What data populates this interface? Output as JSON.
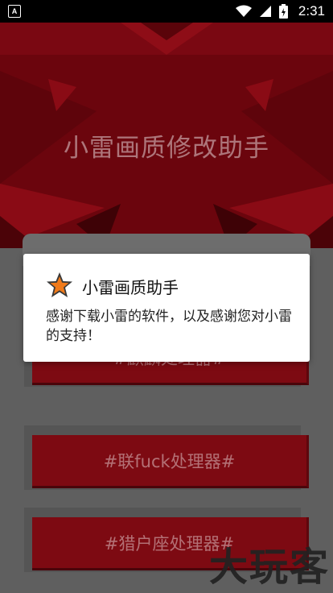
{
  "status_bar": {
    "app_icon_letter": "A",
    "time": "2:31"
  },
  "banner": {
    "title": "小雷画质修改助手"
  },
  "buttons": [
    {
      "label": "#麒麟处理器#"
    },
    {
      "label": "#联fuck处理器#"
    },
    {
      "label": "#猎户座处理器#"
    }
  ],
  "dialog": {
    "title": "小雷画质助手",
    "message": "感谢下载小雷的软件，以及感谢您对小雷的支持！",
    "icon": "star-icon"
  },
  "watermark": {
    "text": "大玩客"
  },
  "colors": {
    "banner_red": "#6b050d",
    "button_red": "#7d0a12",
    "star_orange": "#f07a1a"
  }
}
